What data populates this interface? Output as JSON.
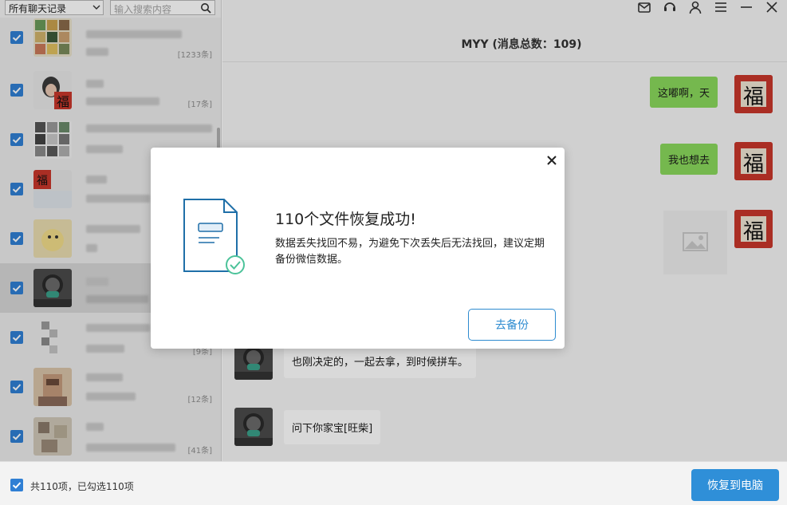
{
  "filter": {
    "selected": "所有聊天记录"
  },
  "search": {
    "placeholder": "输入搜索内容"
  },
  "chat_list": [
    {
      "count": "[1233条]"
    },
    {
      "count": "[17条]"
    },
    {
      "count": ""
    },
    {
      "count": ""
    },
    {
      "count": ""
    },
    {
      "count": ""
    },
    {
      "count": "[9条]"
    },
    {
      "count": "[12条]"
    },
    {
      "count": "[41条]"
    }
  ],
  "window_icons": [
    "mail-icon",
    "headset-icon",
    "user-icon",
    "menu-icon",
    "minimize-icon",
    "close-icon"
  ],
  "chat": {
    "title": "MYY (消息总数：109)",
    "messages": [
      {
        "side": "right",
        "text": "这嘟啊，天"
      },
      {
        "side": "right",
        "text": "我也想去"
      },
      {
        "side": "right",
        "text": ""
      },
      {
        "side": "left",
        "text": "也刚决定的，一起去拿，到时候拼车。"
      },
      {
        "side": "left",
        "text": "问下你家宝[旺柴]"
      }
    ],
    "avatar_glyph": "福"
  },
  "dialog": {
    "title": "110个文件恢复成功!",
    "body": "数据丢失找回不易，为避免下次丢失后无法找回，建议定期备份微信数据。",
    "button": "去备份"
  },
  "bottom": {
    "status": "共110项，已勾选110项",
    "restore_button": "恢复到电脑"
  },
  "colors": {
    "accent": "#2f8fd8",
    "bubble_green": "#8ad95c",
    "checkbox": "#2f7fd4",
    "success": "#4cc39a"
  }
}
